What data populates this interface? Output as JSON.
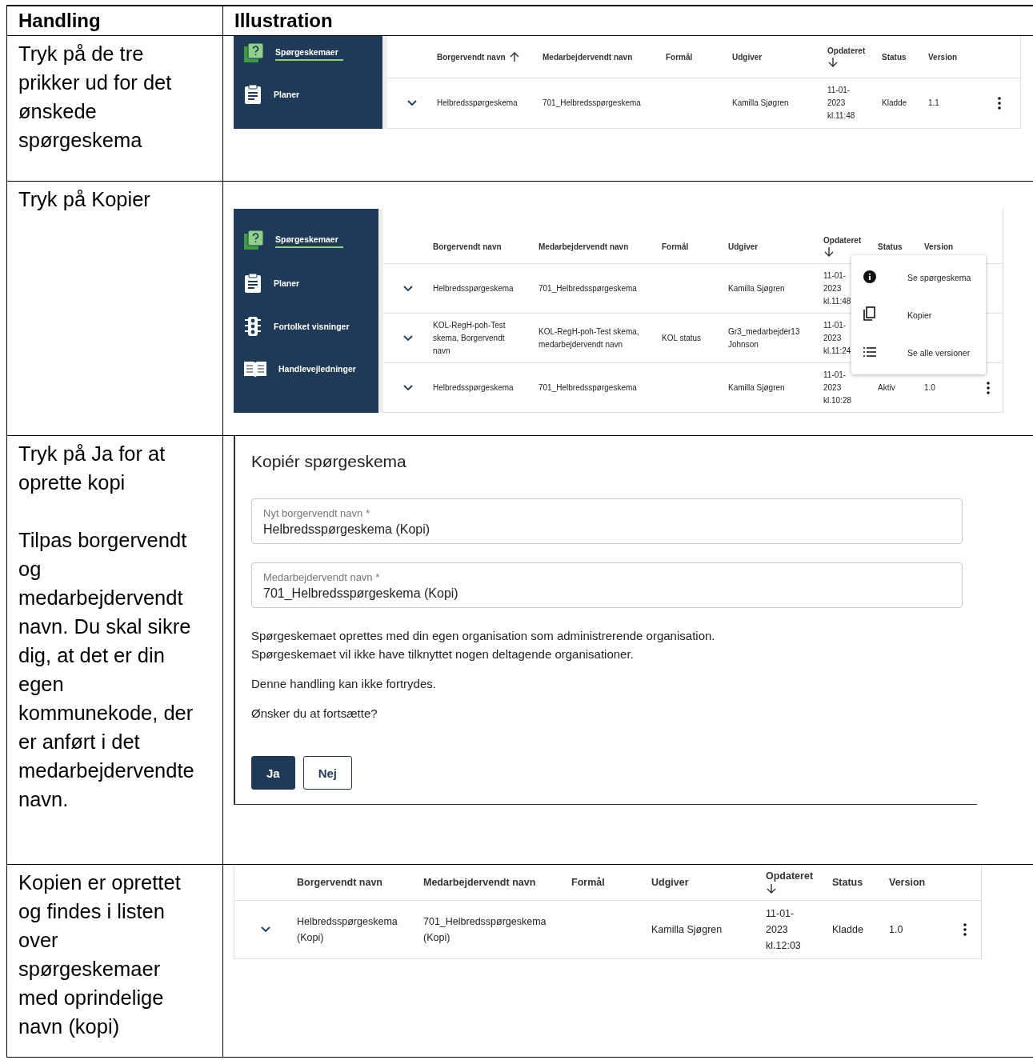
{
  "table": {
    "columns": [
      "Handling",
      "Illustration"
    ],
    "rows": [
      {
        "handling": [
          "Tryk på de tre prikker ud for det ønskede spørgeskema"
        ],
        "illustration": {
          "kind": "list",
          "sidebar": [
            {
              "label": "Spørgeskemaer",
              "selected": true
            },
            {
              "label": "Planer",
              "selected": false
            }
          ],
          "columns": [
            {
              "label": "Borgervendt navn",
              "sorted": true,
              "descending": false
            },
            {
              "label": "Medarbejdervendt navn",
              "sorted": false
            },
            {
              "label": "Formål",
              "sorted": false
            },
            {
              "label": "Udgiver",
              "sorted": false
            },
            {
              "label": "Opdateret",
              "sorted": true,
              "descending": true
            },
            {
              "label": "Status",
              "sorted": false
            },
            {
              "label": "Version",
              "sorted": false
            }
          ],
          "rows": [
            {
              "cells": [
                "Helbredsspørgeskema",
                "701_Helbredsspørgeskema",
                "",
                "Kamilla Sjøgren",
                "11-01-\n2023\nkl.11:48",
                "Kladde",
                "1.1"
              ],
              "menu_button": true
            }
          ]
        }
      },
      {
        "handling": [
          "Tryk på Kopier"
        ],
        "illustration": {
          "kind": "list",
          "sidebar": [
            {
              "label": "Spørgeskemaer",
              "selected": true
            },
            {
              "label": "Planer",
              "selected": false
            },
            {
              "label": "Fortolket visninger",
              "selected": false
            },
            {
              "label": "Handlevejledninger",
              "selected": false
            }
          ],
          "columns": [
            {
              "label": "Borgervendt navn",
              "sorted": false
            },
            {
              "label": "Medarbejdervendt navn",
              "sorted": false
            },
            {
              "label": "Formål",
              "sorted": false
            },
            {
              "label": "Udgiver",
              "sorted": false
            },
            {
              "label": "Opdateret",
              "sorted": true,
              "descending": true
            },
            {
              "label": "Status",
              "sorted": false
            },
            {
              "label": "Version",
              "sorted": false
            }
          ],
          "rows": [
            {
              "cells": [
                "Helbredsspørgeskema",
                "701_Helbredsspørgeskema",
                "",
                "Kamilla Sjøgren",
                "11-01-\n2023\nkl.11:48",
                "",
                ""
              ],
              "menu_button": false
            },
            {
              "cells": [
                "KOL-RegH-poh-Test\nskema, Borgervendt\nnavn",
                "KOL-RegH-poh-Test skema,\nmedarbejdervendt navn",
                "KOL status",
                "Gr3_medarbejder13\nJohnson",
                "11-01-\n2023\nkl.11:24",
                "",
                ""
              ],
              "menu_button": false
            },
            {
              "cells": [
                "Helbredsspørgeskema",
                "701_Helbredsspørgeskema",
                "",
                "Kamilla Sjøgren",
                "11-01-\n2023\nkl.10:28",
                "Aktiv",
                "1.0"
              ],
              "menu_button": true
            }
          ],
          "menu": [
            "Se spørgeskema",
            "Kopier",
            "Se alle versioner"
          ]
        }
      },
      {
        "handling": [
          "Tryk på Ja for at oprette kopi",
          "Tilpas borgervendt og medarbejdervendt navn. Du skal sikre dig, at det er din egen kommunekode, der er anført i det medarbejdervendte navn."
        ],
        "illustration": {
          "kind": "dialog",
          "title": "Kopiér spørgeskema",
          "fields": [
            {
              "label": "Nyt borgervendt navn *",
              "value": "Helbredsspørgeskema  (Kopi)"
            },
            {
              "label": "Medarbejdervendt navn *",
              "value": "701_Helbredsspørgeskema  (Kopi)"
            }
          ],
          "paragraphs": [
            "Spørgeskemaet oprettes med din egen organisation som administrerende organisation.\nSpørgeskemaet vil ikke have tilknyttet nogen deltagende organisationer.",
            "Denne handling kan ikke fortrydes.",
            "Ønsker du at fortsætte?"
          ],
          "buttons": [
            {
              "label": "Ja",
              "kind": "primary"
            },
            {
              "label": "Nej",
              "kind": "secondary"
            }
          ]
        }
      },
      {
        "handling": [
          "Kopien er oprettet og findes i listen over spørgeskemaer med oprindelige navn (kopi)"
        ],
        "illustration": {
          "kind": "list",
          "columns": [
            {
              "label": "Borgervendt navn",
              "sorted": false
            },
            {
              "label": "Medarbejdervendt navn",
              "sorted": false
            },
            {
              "label": "Formål",
              "sorted": false
            },
            {
              "label": "Udgiver",
              "sorted": false
            },
            {
              "label": "Opdateret",
              "sorted": true,
              "descending": true
            },
            {
              "label": "Status",
              "sorted": false
            },
            {
              "label": "Version",
              "sorted": false
            }
          ],
          "rows": [
            {
              "cells": [
                "Helbredsspørgeskema\n(Kopi)",
                "701_Helbredsspørgeskema\n(Kopi)",
                "",
                "Kamilla Sjøgren",
                "11-01-\n2023\nkl.12:03",
                "Kladde",
                "1.0"
              ],
              "menu_button": true
            }
          ]
        }
      }
    ]
  }
}
